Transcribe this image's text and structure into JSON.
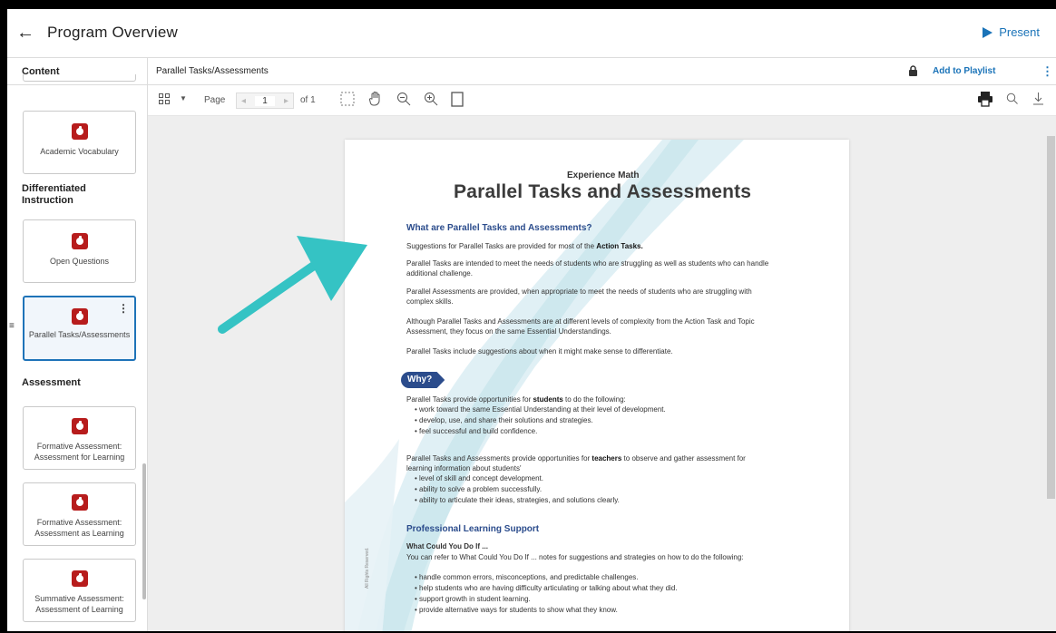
{
  "header": {
    "back_icon": "arrow-left-icon",
    "title": "Program Overview",
    "present_label": "Present"
  },
  "sidebar": {
    "header": "Content",
    "sections": {
      "differentiated": "Differentiated Instruction",
      "assessment": "Assessment"
    },
    "items": [
      {
        "label": "Academic Vocabulary"
      },
      {
        "label": "Open Questions"
      },
      {
        "label": "Parallel Tasks/Assessments",
        "active": true
      },
      {
        "label": "Formative Assessment: Assessment for Learning"
      },
      {
        "label": "Formative Assessment: Assessment as Learning"
      },
      {
        "label": "Summative Assessment: Assessment of Learning"
      }
    ]
  },
  "doc": {
    "title": "Parallel Tasks/Assessments",
    "add_playlist": "Add to Playlist"
  },
  "toolbar": {
    "page_label": "Page",
    "page_value": "1",
    "of_label": "of 1"
  },
  "page": {
    "subtitle": "Experience Math",
    "title": "Parallel Tasks and Assessments",
    "h1": "What are Parallel Tasks and Assessments?",
    "p1_pre": "Suggestions for Parallel Tasks are provided for most of the ",
    "p1_bold": "Action Tasks.",
    "p2": "Parallel Tasks are intended to meet the needs of students who are struggling as well as students who can handle additional challenge.",
    "p3": "Parallel Assessments are provided, when appropriate to meet the needs of students who are struggling with complex skills.",
    "p4": "Although Parallel Tasks and Assessments are at different levels of complexity from the Action Task and Topic Assessment, they focus on the same Essential Understandings.",
    "p5": "Parallel Tasks include suggestions about when it might make sense to differentiate.",
    "why": "Why?",
    "p6_pre": "Parallel Tasks provide opportunities for ",
    "p6_bold": "students",
    "p6_post": " to do the following:",
    "b1": "• work toward the same Essential Understanding at their level of development.",
    "b2": "• develop, use, and share their solutions and strategies.",
    "b3": "• feel successful and build confidence.",
    "p7_pre": "Parallel Tasks and Assessments provide opportunities for ",
    "p7_bold": "teachers",
    "p7_post": " to observe and gather assessment for learning information about students'",
    "b4": "• level of skill and concept development.",
    "b5": "• ability to solve a problem successfully.",
    "b6": "• ability to articulate their ideas, strategies, and solutions clearly.",
    "h2": "Professional Learning Support",
    "h3": "What Could You Do If ...",
    "p8": "You can refer to What Could You Do If ... notes for suggestions and strategies on how to do the following:",
    "b7": "• handle common errors, misconceptions, and predictable challenges.",
    "b8": "• help students who are having difficulty articulating or talking about what they did.",
    "b9": "• support growth in student learning.",
    "b10": "• provide alternative ways for students to show what they know.",
    "rights": "All Rights Reserved."
  },
  "colors": {
    "accent": "#1a73b8",
    "apple": "#b71c1c",
    "heading": "#2b4c8c",
    "arrow": "#35c3c4"
  }
}
